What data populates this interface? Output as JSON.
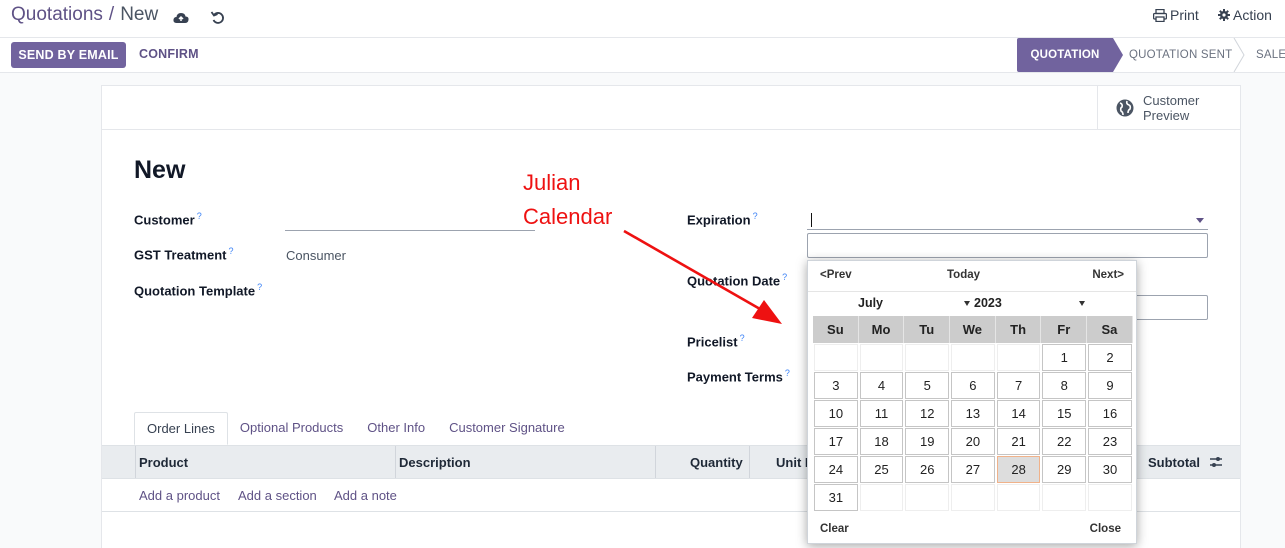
{
  "breadcrumb": {
    "parent": "Quotations",
    "separator": "/",
    "current": "New"
  },
  "toolbar": {
    "print_label": "Print",
    "action_label": "Action"
  },
  "control": {
    "send_email_label": "SEND BY EMAIL",
    "confirm_label": "CONFIRM",
    "statuses": [
      {
        "label": "QUOTATION",
        "active": true
      },
      {
        "label": "QUOTATION SENT",
        "active": false
      },
      {
        "label": "SALES",
        "active": false
      }
    ]
  },
  "sheet": {
    "preview_label": "Customer Preview",
    "title": "New",
    "fields": {
      "customer": "Customer",
      "gst": "GST Treatment",
      "gst_value": "Consumer",
      "template": "Quotation Template",
      "expiration": "Expiration",
      "quotation_date": "Quotation Date",
      "pricelist": "Pricelist",
      "payment_terms": "Payment Terms",
      "help_mark": "?"
    }
  },
  "annotation": {
    "line1": "Julian",
    "line2": "Calendar",
    "color": "#ee1111"
  },
  "tabs": [
    "Order Lines",
    "Optional Products",
    "Other Info",
    "Customer Signature"
  ],
  "order_table": {
    "headers": [
      "Product",
      "Description",
      "Quantity",
      "Unit P",
      "Subtotal"
    ],
    "add_links": [
      "Add a product",
      "Add a section",
      "Add a note"
    ]
  },
  "datepicker": {
    "prev": "<Prev",
    "today": "Today",
    "next": "Next>",
    "month": "July",
    "year": "2023",
    "weekdays": [
      "Su",
      "Mo",
      "Tu",
      "We",
      "Th",
      "Fr",
      "Sa"
    ],
    "weeks": [
      [
        "",
        "",
        "",
        "",
        "",
        "1",
        "2"
      ],
      [
        "3",
        "4",
        "5",
        "6",
        "7",
        "8",
        "9"
      ],
      [
        "10",
        "11",
        "12",
        "13",
        "14",
        "15",
        "16"
      ],
      [
        "17",
        "18",
        "19",
        "20",
        "21",
        "22",
        "23"
      ],
      [
        "24",
        "25",
        "26",
        "27",
        "28",
        "29",
        "30"
      ],
      [
        "31",
        "",
        "",
        "",
        "",
        "",
        ""
      ]
    ],
    "selected_day": "28",
    "clear": "Clear",
    "close": "Close"
  },
  "colors": {
    "primary": "#71639e",
    "link": "#5f5286"
  }
}
